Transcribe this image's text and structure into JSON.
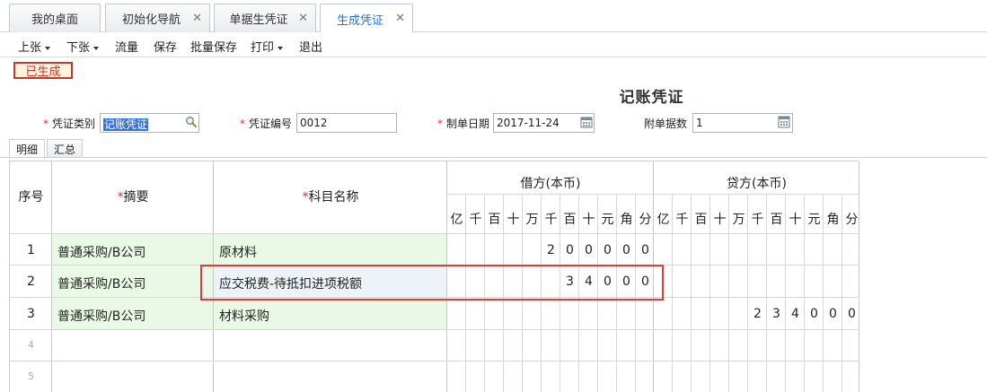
{
  "tabs": [
    {
      "label": "我的桌面",
      "closable": false,
      "active": false
    },
    {
      "label": "初始化导航",
      "closable": true,
      "active": false
    },
    {
      "label": "单据生凭证",
      "closable": true,
      "active": false
    },
    {
      "label": "生成凭证",
      "closable": true,
      "active": true
    }
  ],
  "toolbar": {
    "prev": "上张",
    "next": "下张",
    "flow": "流量",
    "save": "保存",
    "batch_save": "批量保存",
    "print": "打印",
    "exit": "退出"
  },
  "status_badge": "已生成",
  "voucher_title": "记账凭证",
  "fields": {
    "category_label": "凭证类别",
    "category_value": "记账凭证",
    "number_label": "凭证编号",
    "number_value": "0012",
    "date_label": "制单日期",
    "date_value": "2017-11-24",
    "attachments_label": "附单据数",
    "attachments_value": "1"
  },
  "subtabs": {
    "detail": "明细",
    "summary": "汇总"
  },
  "grid": {
    "col_index": "序号",
    "col_summary": "摘要",
    "col_account": "科目名称",
    "col_debit": "借方(本币)",
    "col_credit": "贷方(本币)",
    "digit_units": [
      "亿",
      "千",
      "百",
      "十",
      "万",
      "千",
      "百",
      "十",
      "元",
      "角",
      "分"
    ],
    "rows": [
      {
        "index": "1",
        "summary": "普通采购/B公司",
        "account": "原材料",
        "debit": [
          "",
          "",
          "",
          "",
          "",
          "2",
          "0",
          "0",
          "0",
          "0",
          "0"
        ],
        "credit": [
          "",
          "",
          "",
          "",
          "",
          "",
          "",
          "",
          "",
          "",
          ""
        ]
      },
      {
        "index": "2",
        "summary": "普通采购/B公司",
        "account": "应交税费-待抵扣进项税额",
        "debit": [
          "",
          "",
          "",
          "",
          "",
          "",
          "3",
          "4",
          "0",
          "0",
          "0"
        ],
        "credit": [
          "",
          "",
          "",
          "",
          "",
          "",
          "",
          "",
          "",
          "",
          ""
        ]
      },
      {
        "index": "3",
        "summary": "普通采购/B公司",
        "account": "材料采购",
        "debit": [
          "",
          "",
          "",
          "",
          "",
          "",
          "",
          "",
          "",
          "",
          ""
        ],
        "credit": [
          "",
          "",
          "",
          "",
          "",
          "2",
          "3",
          "4",
          "0",
          "0",
          "0"
        ]
      },
      {
        "index": "4",
        "summary": "",
        "account": "",
        "debit": [
          "",
          "",
          "",
          "",
          "",
          "",
          "",
          "",
          "",
          "",
          ""
        ],
        "credit": [
          "",
          "",
          "",
          "",
          "",
          "",
          "",
          "",
          "",
          "",
          ""
        ]
      },
      {
        "index": "5",
        "summary": "",
        "account": "",
        "debit": [
          "",
          "",
          "",
          "",
          "",
          "",
          "",
          "",
          "",
          "",
          ""
        ],
        "credit": [
          "",
          "",
          "",
          "",
          "",
          "",
          "",
          "",
          "",
          "",
          ""
        ]
      }
    ]
  },
  "colors": {
    "accent": "#1d74d0",
    "highlight": "#e03a3a",
    "green_cell": "#eaf9e6",
    "blue_cell": "#eef2f9"
  }
}
